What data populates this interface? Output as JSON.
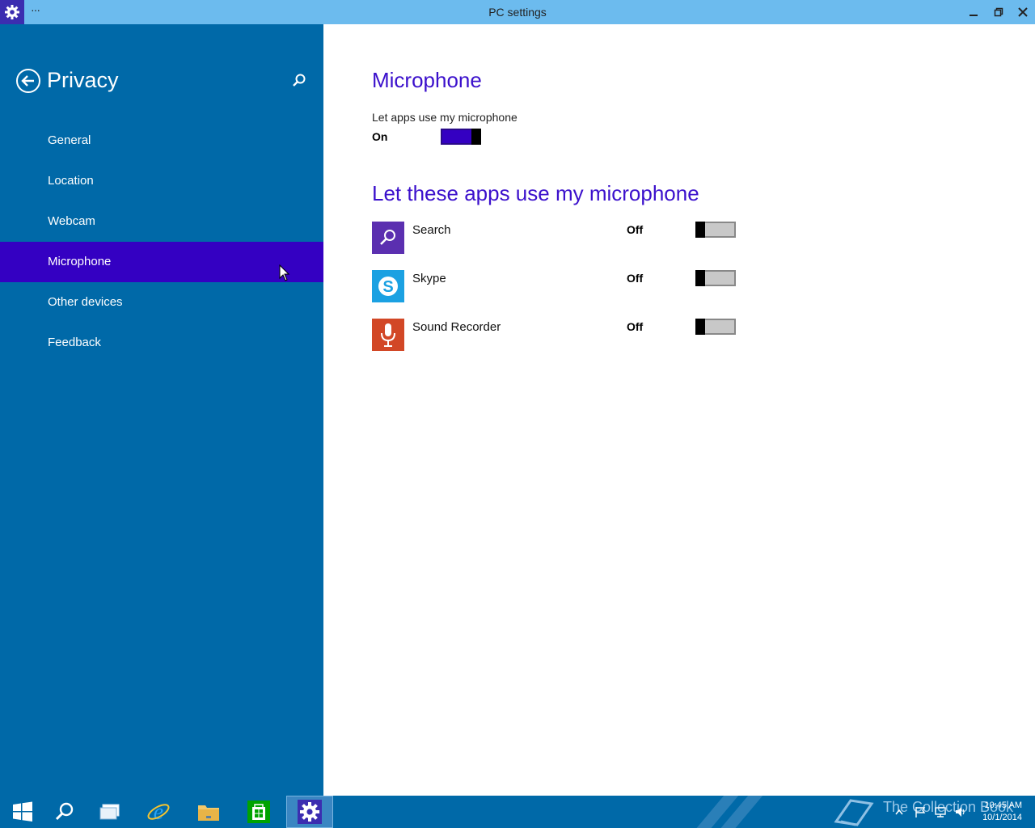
{
  "window": {
    "title": "PC settings",
    "menu_dots": "···"
  },
  "sidebar": {
    "heading": "Privacy",
    "items": [
      {
        "label": "General"
      },
      {
        "label": "Location"
      },
      {
        "label": "Webcam"
      },
      {
        "label": "Microphone",
        "active": true
      },
      {
        "label": "Other devices"
      },
      {
        "label": "Feedback"
      }
    ]
  },
  "main": {
    "title": "Microphone",
    "master_label": "Let apps use my microphone",
    "master_state": "On",
    "apps_title": "Let these apps use my microphone",
    "apps": [
      {
        "name": "Search",
        "state": "Off",
        "icon": "search-icon",
        "color": "#5b2fb0"
      },
      {
        "name": "Skype",
        "state": "Off",
        "icon": "skype-icon",
        "color": "#1ba1e2"
      },
      {
        "name": "Sound Recorder",
        "state": "Off",
        "icon": "microphone-icon",
        "color": "#d24726"
      }
    ]
  },
  "taskbar": {
    "watermark": "The Collection Book",
    "time": "10:45 AM",
    "date": "10/1/2014"
  },
  "colors": {
    "accent": "#3400c2",
    "sidebar": "#0069a8",
    "titlebar": "#6cbbee"
  }
}
